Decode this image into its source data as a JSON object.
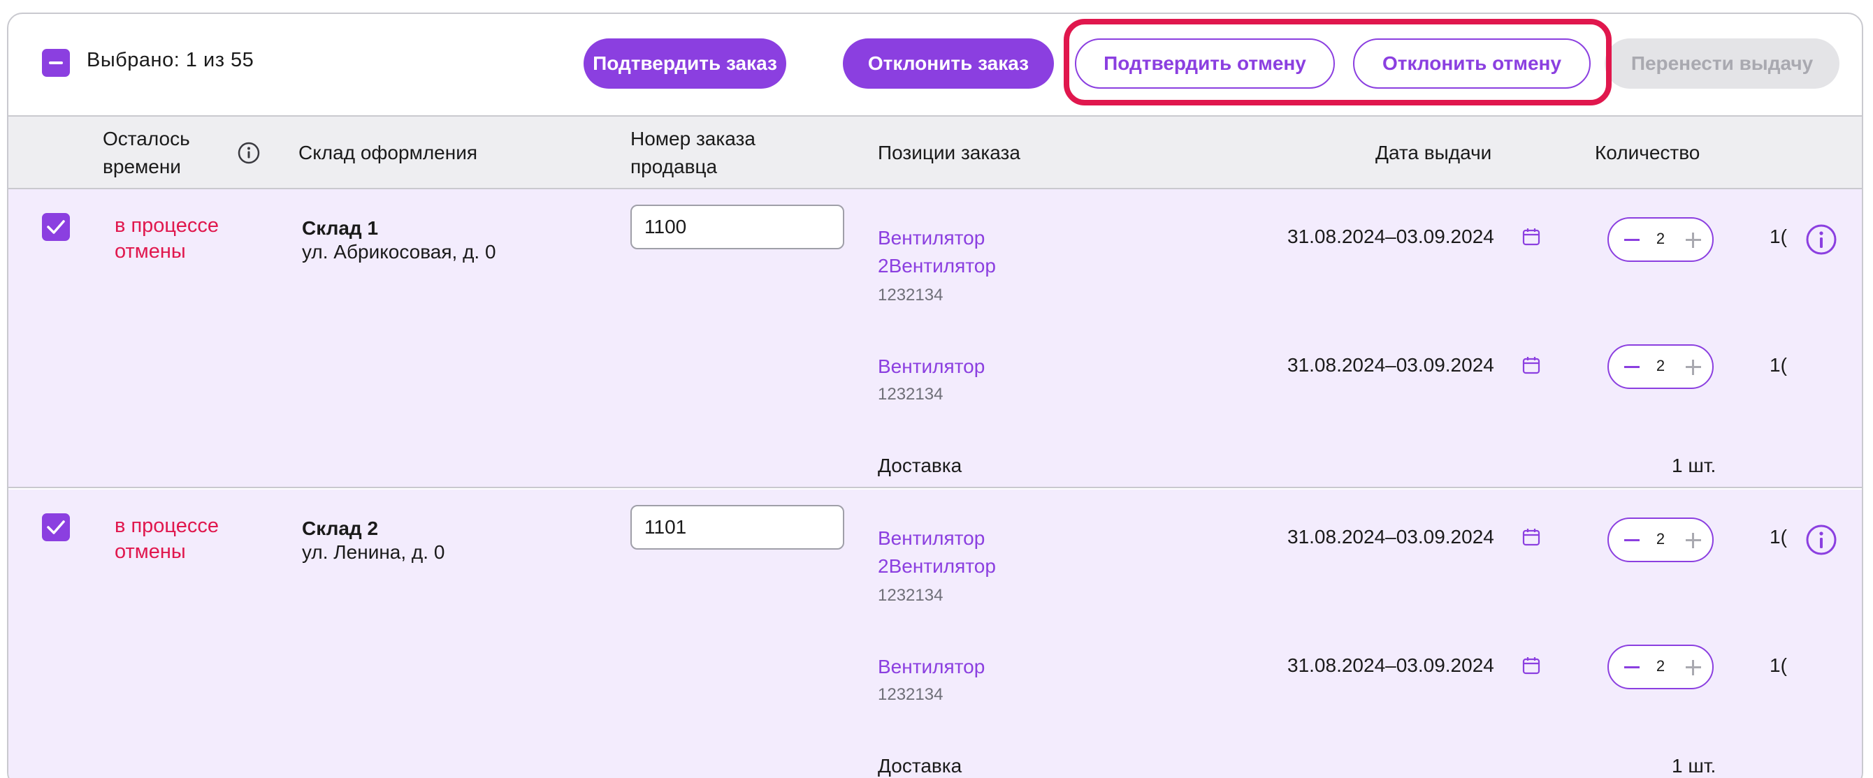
{
  "toolbar": {
    "selected_label": "Выбрано: 1 из 55",
    "confirm_order": "Подтвердить заказ",
    "reject_order": "Отклонить заказ",
    "confirm_cancel": "Подтвердить отмену",
    "reject_cancel": "Отклонить отмену",
    "reschedule": "Перенести выдачу"
  },
  "columns": {
    "time_left_1": "Осталось",
    "time_left_2": "времени",
    "warehouse": "Склад оформления",
    "order_no_1": "Номер заказа",
    "order_no_2": "продавца",
    "positions": "Позиции заказа",
    "date": "Дата выдачи",
    "quantity": "Количество"
  },
  "rows": [
    {
      "status_1": "в процессе",
      "status_2": "отмены",
      "warehouse_name": "Склад 1",
      "warehouse_address": "ул. Абрикосовая, д. 0",
      "order_number": "1100",
      "items": [
        {
          "name_1": "Вентилятор",
          "name_2": "2Вентилятор",
          "sku": "1232134",
          "date": "31.08.2024–03.09.2024",
          "qty": "2",
          "cut": "1("
        },
        {
          "name_1": "Вентилятор",
          "sku": "1232134",
          "date": "31.08.2024–03.09.2024",
          "qty": "2",
          "cut": "1("
        }
      ],
      "delivery_label": "Доставка",
      "delivery_qty": "1 шт."
    },
    {
      "status_1": "в процессе",
      "status_2": "отмены",
      "warehouse_name": "Склад 2",
      "warehouse_address": "ул. Ленина, д. 0",
      "order_number": "1101",
      "items": [
        {
          "name_1": "Вентилятор",
          "name_2": "2Вентилятор",
          "sku": "1232134",
          "date": "31.08.2024–03.09.2024",
          "qty": "2",
          "cut": "1("
        },
        {
          "name_1": "Вентилятор",
          "sku": "1232134",
          "date": "31.08.2024–03.09.2024",
          "qty": "2",
          "cut": "1("
        }
      ],
      "delivery_label": "Доставка",
      "delivery_qty": "1 шт."
    }
  ],
  "icons": {
    "info": "info-icon",
    "calendar": "calendar-icon",
    "check": "check-icon",
    "minus": "minus-icon",
    "plus": "plus-icon"
  },
  "colors": {
    "accent": "#8b3fe0",
    "alert": "#e0174d",
    "row_bg": "#f3ecfd",
    "header_bg": "#eeeef1",
    "disabled_bg": "#e4e4e7"
  }
}
